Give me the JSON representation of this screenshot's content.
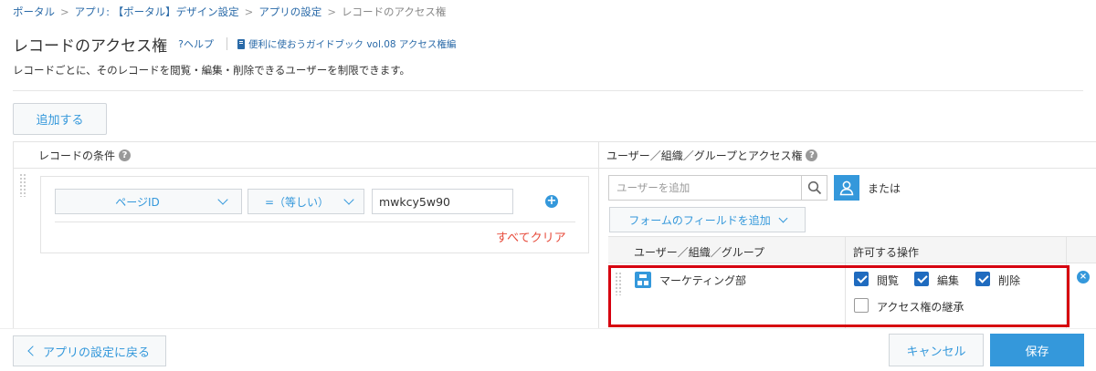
{
  "breadcrumb": {
    "items": [
      "ポータル",
      "アプリ: 【ポータル】デザイン設定",
      "アプリの設定",
      "レコードのアクセス権"
    ],
    "separator": ">"
  },
  "header": {
    "title": "レコードのアクセス権",
    "help": "?ヘルプ",
    "guide": "便利に使おうガイドブック vol.08 アクセス権編"
  },
  "description": "レコードごとに、そのレコードを閲覧・編集・削除できるユーザーを制限できます。",
  "add_button": "追加する",
  "left": {
    "heading": "レコードの条件",
    "field_select": "ページID",
    "operator_select": "=（等しい）",
    "value": "mwkcy5w90",
    "clear_all": "すべてクリア"
  },
  "right": {
    "heading": "ユーザー／組織／グループとアクセス権",
    "user_placeholder": "ユーザーを追加",
    "or": "または",
    "add_field": "フォームのフィールドを追加",
    "col_entity": "ユーザー／組織／グループ",
    "col_permissions": "許可する操作",
    "row": {
      "name": "マーケティング部",
      "perm_view": "閲覧",
      "perm_edit": "編集",
      "perm_delete": "削除",
      "perm_inherit": "アクセス権の継承"
    }
  },
  "footer": {
    "back": "アプリの設定に戻る",
    "cancel": "キャンセル",
    "save": "保存"
  },
  "colors": {
    "link": "#2a6aa8",
    "accent": "#3498db",
    "danger": "#e74c3c",
    "highlight": "#d6000f"
  }
}
